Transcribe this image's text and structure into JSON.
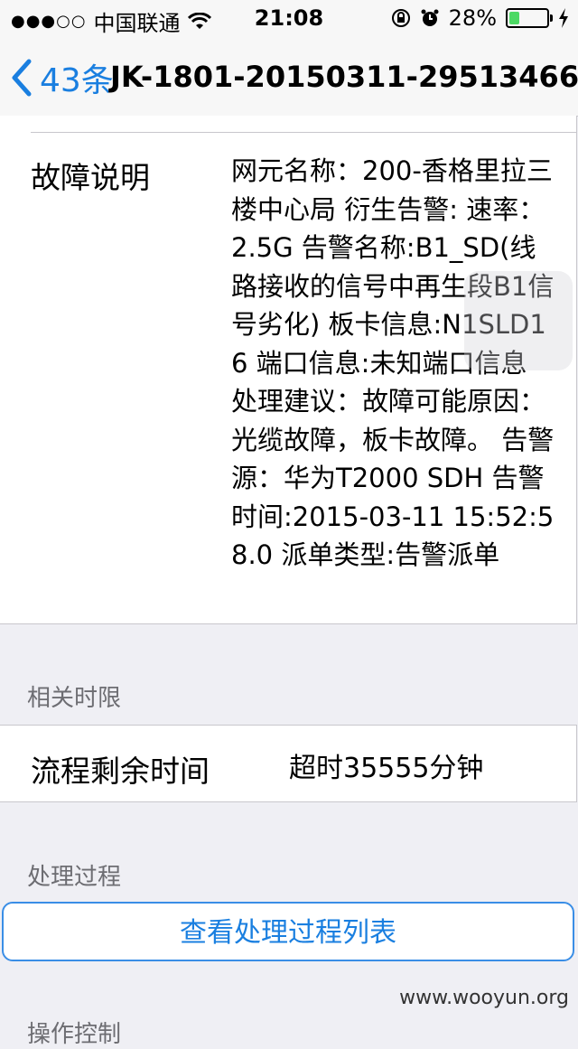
{
  "status": {
    "carrier": "中国联通",
    "time": "21:08",
    "battery": "28%",
    "battery_level": 0.28
  },
  "nav": {
    "back_label": "43条",
    "title": "JK-1801-20150311-29513466"
  },
  "fault": {
    "label": "故障说明",
    "text": "网元名称：200-香格里拉三楼中心局 衍生告警: 速率：2.5G 告警名称:B1_SD(线路接收的信号中再生段B1信号劣化) 板卡信息:N1SLD16 端口信息:未知端口信息 处理建议：故障可能原因：光缆故障，板卡故障。 告警源：华为T2000 SDH 告警时间:2015-03-11 15:52:58.0 派单类型:告警派单"
  },
  "deadline": {
    "header": "相关时限",
    "label": "流程剩余时间",
    "value": "超时35555分钟"
  },
  "process": {
    "header": "处理过程",
    "button": "查看处理过程列表"
  },
  "next_header_partial": "操作控制",
  "watermark": "www.wooyun.org"
}
